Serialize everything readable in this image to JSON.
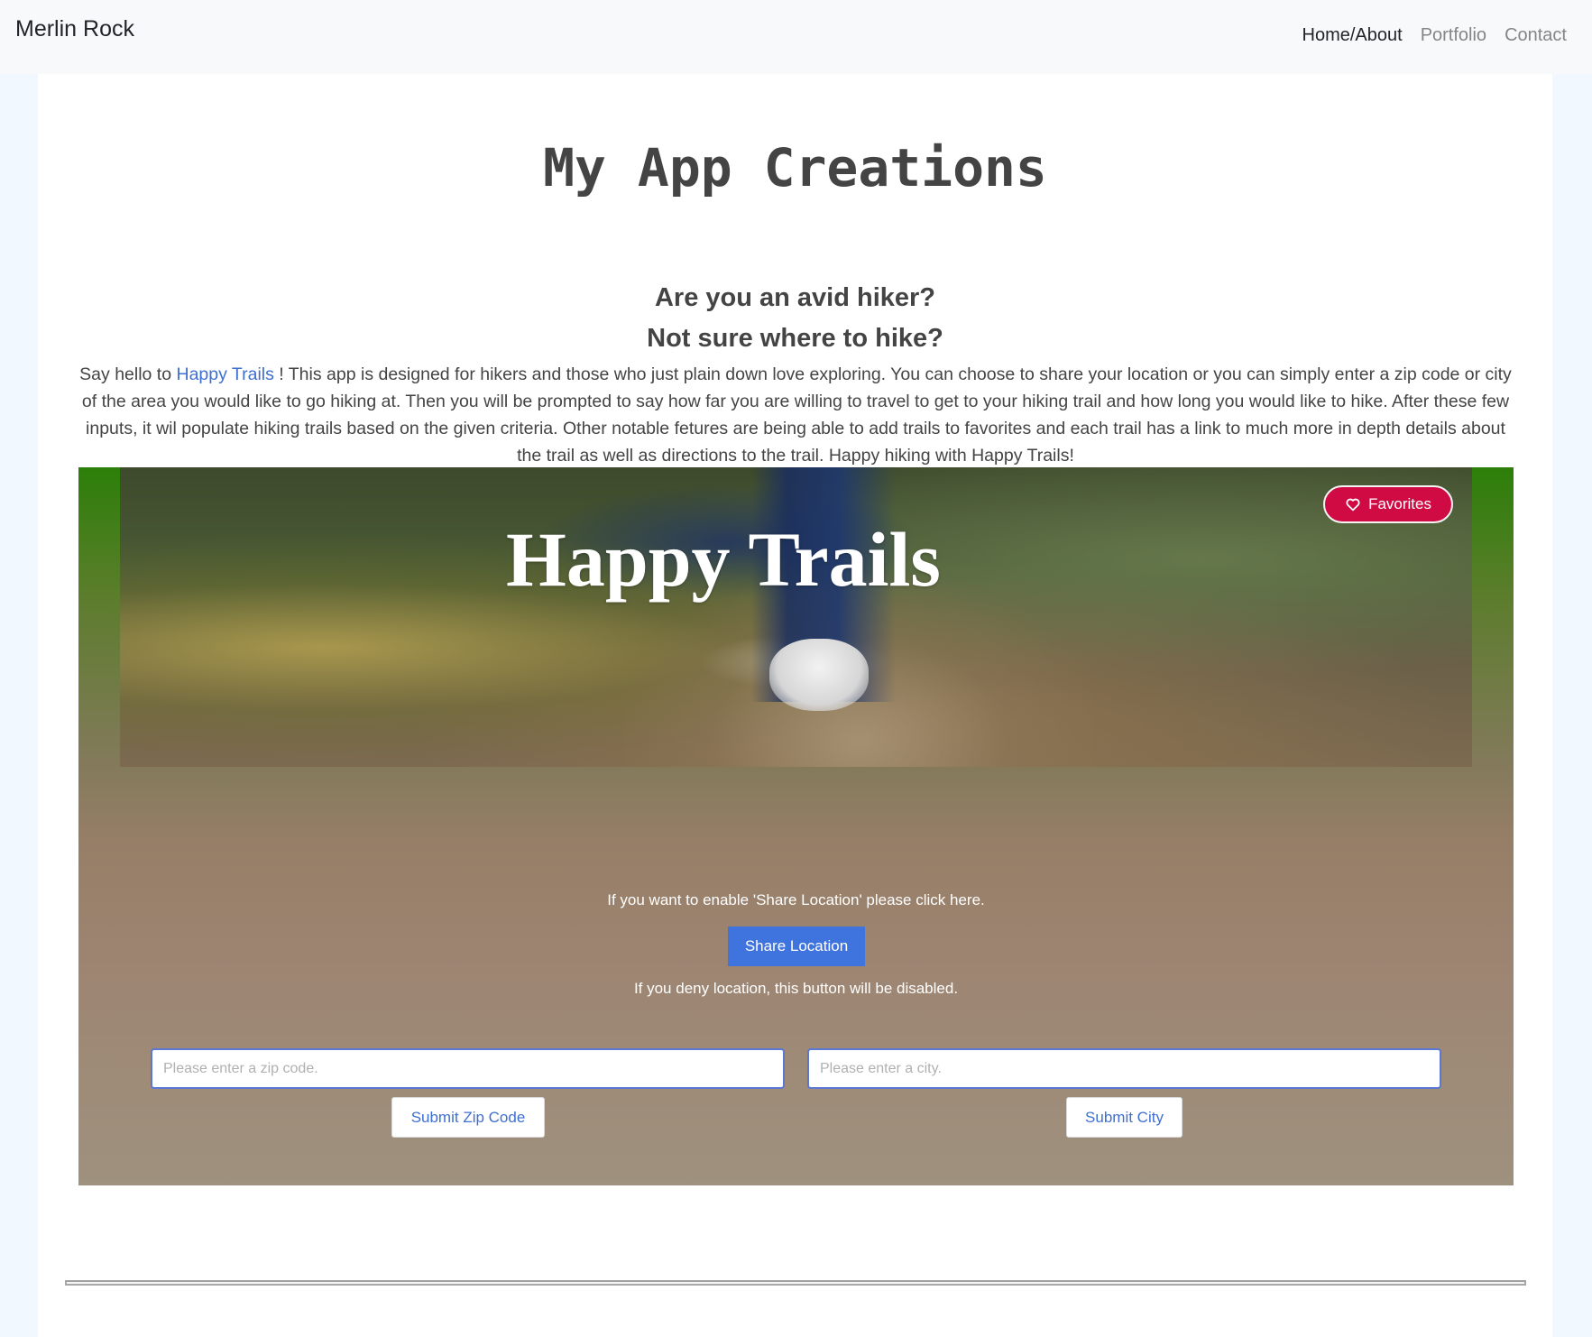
{
  "navbar": {
    "brand": "Merlin Rock",
    "links": [
      {
        "label": "Home/About",
        "active": true
      },
      {
        "label": "Portfolio",
        "active": false
      },
      {
        "label": "Contact",
        "active": false
      }
    ]
  },
  "main": {
    "title": "My App Creations",
    "subheading_1": "Are you an avid hiker?",
    "subheading_2": "Not sure where to hike?",
    "description_prefix": "Say hello to ",
    "description_link": "Happy Trails",
    "description_body": " ! This app is designed for hikers and those who just plain down love exploring. You can choose to share your location or you can simply enter a zip code or city of the area you would like to go hiking at. Then you will be prompted to say how far you are willing to travel to get to your hiking trail and how long you would like to hike. After these few inputs, it wil populate hiking trails based on the given criteria. Other notable fetures are being able to add trails to favorites and each trail has a link to much more in depth details about the trail as well as directions to the trail. Happy hiking with Happy Trails!"
  },
  "app_preview": {
    "hero_title": "Happy Trails",
    "favorites_label": "Favorites",
    "share_prompt": "If you want to enable 'Share Location' please click here.",
    "share_button": "Share Location",
    "deny_note": "If you deny location, this button will be disabled.",
    "zip_placeholder": "Please enter a zip code.",
    "city_placeholder": "Please enter a city.",
    "submit_zip": "Submit Zip Code",
    "submit_city": "Submit City",
    "colors": {
      "favorites": "#d00b44",
      "share_button": "#3f74de",
      "link": "#3f6fd0"
    },
    "icons": {
      "favorites": "heart-outline-icon"
    }
  }
}
